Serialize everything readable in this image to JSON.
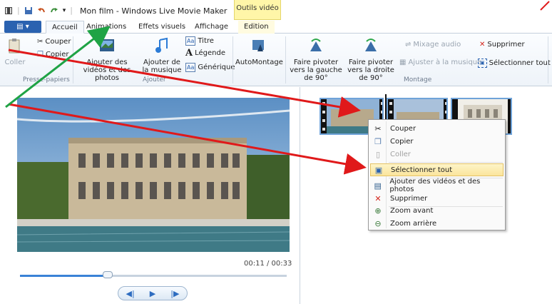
{
  "window": {
    "title": "Mon film - Windows Live Movie Maker",
    "context_group": "Outils vidéo"
  },
  "tabs": {
    "file_label": "▤ ▾",
    "items": [
      "Accueil",
      "Animations",
      "Effets visuels",
      "Affichage",
      "Edition"
    ],
    "active": "Accueil"
  },
  "ribbon": {
    "clipboard": {
      "paste": "Coller",
      "cut": "Couper",
      "copy": "Copier",
      "group": "Presse-papiers"
    },
    "add": {
      "add_videos": "Ajouter des vidéos et des photos",
      "add_music": "Ajouter de la musique",
      "title": "Titre",
      "caption": "Légende",
      "credits": "Générique",
      "group": "Ajouter"
    },
    "automovie": "AutoMontage",
    "edit": {
      "rotate_left": "Faire pivoter vers la gauche de 90°",
      "rotate_right": "Faire pivoter vers la droite de 90°",
      "audio_mix": "Mixage audio",
      "fit_music": "Ajuster à la musique",
      "delete": "Supprimer",
      "select_all": "Sélectionner tout",
      "group": "Montage"
    }
  },
  "preview": {
    "timecode": "00:11 / 00:33",
    "progress": 0.33
  },
  "context_menu": {
    "items": [
      {
        "label": "Couper",
        "icon": "scissors-icon",
        "disabled": false
      },
      {
        "label": "Copier",
        "icon": "copy-icon",
        "disabled": false
      },
      {
        "label": "Coller",
        "icon": "paste-icon",
        "disabled": true
      },
      {
        "label": "Sélectionner tout",
        "icon": "select-all-icon",
        "disabled": false,
        "highlighted": true
      },
      {
        "label": "Ajouter des vidéos et des photos",
        "icon": "add-media-icon",
        "disabled": false
      },
      {
        "label": "Supprimer",
        "icon": "delete-x-icon",
        "disabled": false
      },
      {
        "label": "Zoom avant",
        "icon": "zoom-in-icon",
        "disabled": false
      },
      {
        "label": "Zoom arrière",
        "icon": "zoom-out-icon",
        "disabled": false
      }
    ]
  },
  "colors": {
    "accent": "#2a62b0",
    "arrow_red": "#e0191a",
    "arrow_green": "#1fa345",
    "highlight": "#fbe59c"
  }
}
